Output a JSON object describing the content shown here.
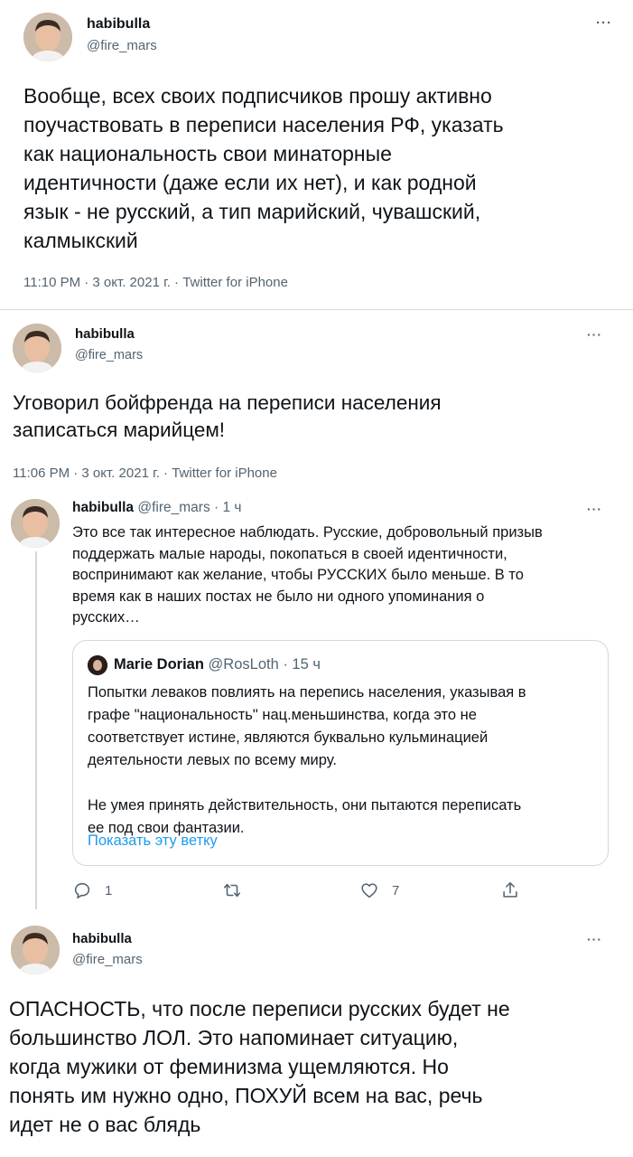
{
  "tweets": [
    {
      "author": {
        "name": "habibulla",
        "handle": "@fire_mars"
      },
      "more_label": "···",
      "text": "Вообще, всех своих подписчиков прошу активно\nпоучаствовать в переписи населения РФ, указать\nкак национальность свои минаторные\nидентичности (даже если их нет), и как родной\nязык - не русский, а тип марийский, чувашский,\nкалмыкский",
      "meta": "11:10 PM · 3 окт. 2021 г. · Twitter for iPhone"
    },
    {
      "author": {
        "name": "habibulla",
        "handle": "@fire_mars"
      },
      "more_label": "···",
      "text": "Уговорил бойфренда на переписи населения\nзаписаться марийцем!",
      "meta": "11:06 PM · 3 окт. 2021 г. · Twitter for iPhone"
    },
    {
      "author": {
        "name": "habibulla",
        "handle": "@fire_mars"
      },
      "more_label": "···",
      "text": "ОПАСНОСТЬ, что после переписи русских будет не\nбольшинство ЛОЛ. Это напоминает ситуацию,\nкогда мужики от феминизма ущемляются. Но\nпонять им нужно одно, ПОХУЙ всем на вас, речь\nидет не о вас блядь"
    }
  ],
  "reply": {
    "author": {
      "name": "habibulla",
      "handle": "@fire_mars"
    },
    "time": " · 1 ч",
    "more_label": "···",
    "text": "Это все так интересное наблюдать. Русские, добровольный призыв\nподдержать малые народы, покопаться в своей идентичности,\nвоспринимают как желание, чтобы РУССКИХ было меньше. В то\nвремя как в наших постах не было ни одного упоминания о\nрусских…",
    "quote": {
      "author": {
        "name": "Marie Dorian",
        "handle": "@RosLoth"
      },
      "time": " · 15 ч",
      "text": "Попытки леваков повлиять на перепись населения, указывая в\nграфе \"национальность\" нац.меньшинства, когда это не\nсоответствует истине, являются буквально кульминацией\nдеятельности левых по всему миру.\n\nНе умея принять действительность, они пытаются переписать\nее под свои фантазии.",
      "show_thread_label": "Показать эту ветку"
    },
    "actions": {
      "reply_count": "1",
      "retweet_count": "",
      "like_count": "7",
      "icons": [
        "reply-icon",
        "retweet-icon",
        "like-icon",
        "share-icon"
      ]
    }
  },
  "colors": {
    "text": "#0f1419",
    "secondary": "#536471",
    "link": "#1d9bf0",
    "border": "#cfd9de"
  }
}
